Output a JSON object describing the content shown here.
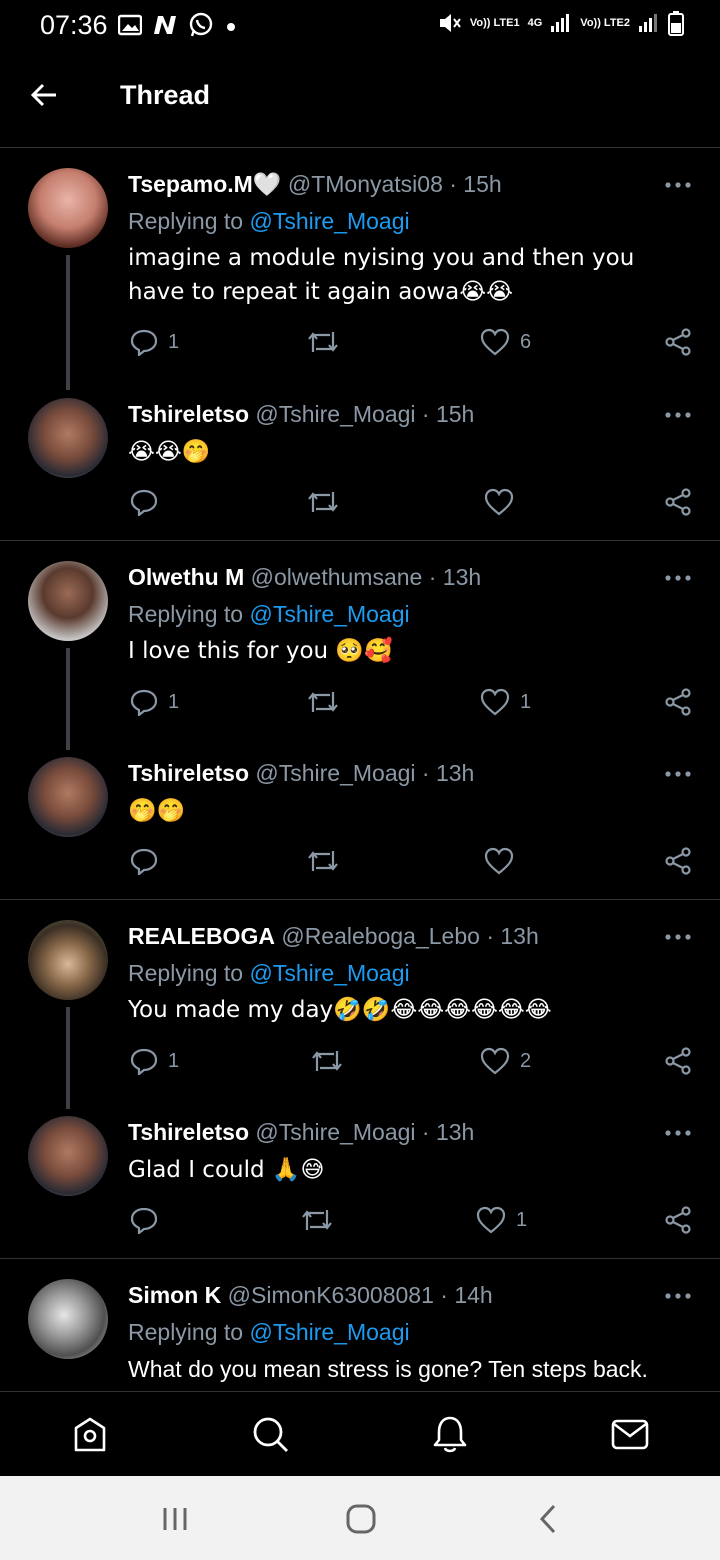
{
  "status_bar": {
    "time": "07:36",
    "left_icons": [
      "gallery-icon",
      "n-app-icon",
      "whatsapp-icon",
      "dot-icon"
    ],
    "network_labels": [
      "Vo)) LTE1",
      "4G",
      "Vo)) LTE2"
    ]
  },
  "header": {
    "title": "Thread"
  },
  "tweets": [
    {
      "name": "Tsepamo.M🤍",
      "handle": "@TMonyatsi08",
      "time": "· 15h",
      "replying_label": "Replying to",
      "replying_to": "@Tshire_Moagi",
      "text": "imagine a module nyising you and then you have to repeat it again aowa😭😭",
      "reply_count": "1",
      "like_count": "6"
    },
    {
      "name": "Tshireletso",
      "handle": "@Tshire_Moagi",
      "time": "· 15h",
      "text": "😭😭🤭",
      "reply_count": "",
      "like_count": ""
    },
    {
      "name": "Olwethu M",
      "handle": "@olwethumsane",
      "time": "· 13h",
      "replying_label": "Replying to",
      "replying_to": "@Tshire_Moagi",
      "text": "I love this for you 🥺🥰",
      "reply_count": "1",
      "like_count": "1"
    },
    {
      "name": "Tshireletso",
      "handle": "@Tshire_Moagi",
      "time": "· 13h",
      "text": "🤭🤭",
      "reply_count": "",
      "like_count": ""
    },
    {
      "name": "REALEBOGA",
      "handle": "@Realeboga_Lebo",
      "time": "· 13h",
      "replying_label": "Replying to",
      "replying_to": "@Tshire_Moagi",
      "text": "You made my day🤣🤣😂😂😂😂😂😂",
      "reply_count": "1",
      "like_count": "2"
    },
    {
      "name": "Tshireletso",
      "handle": "@Tshire_Moagi",
      "time": "· 13h",
      "text": "Glad I could 🙏😅",
      "reply_count": "",
      "like_count": "1"
    },
    {
      "name": "Simon K",
      "handle": "@SimonK63008081",
      "time": "· 14h",
      "replying_label": "Replying to",
      "replying_to": "@Tshire_Moagi",
      "text": "What do you mean stress is gone? Ten steps back."
    }
  ],
  "tab_bar": [
    "home-icon",
    "search-icon",
    "notifications-icon",
    "messages-icon"
  ],
  "colors": {
    "background": "#000000",
    "secondary_text": "#8b98a5",
    "link": "#1d9bf0",
    "divider": "#2f3336"
  }
}
